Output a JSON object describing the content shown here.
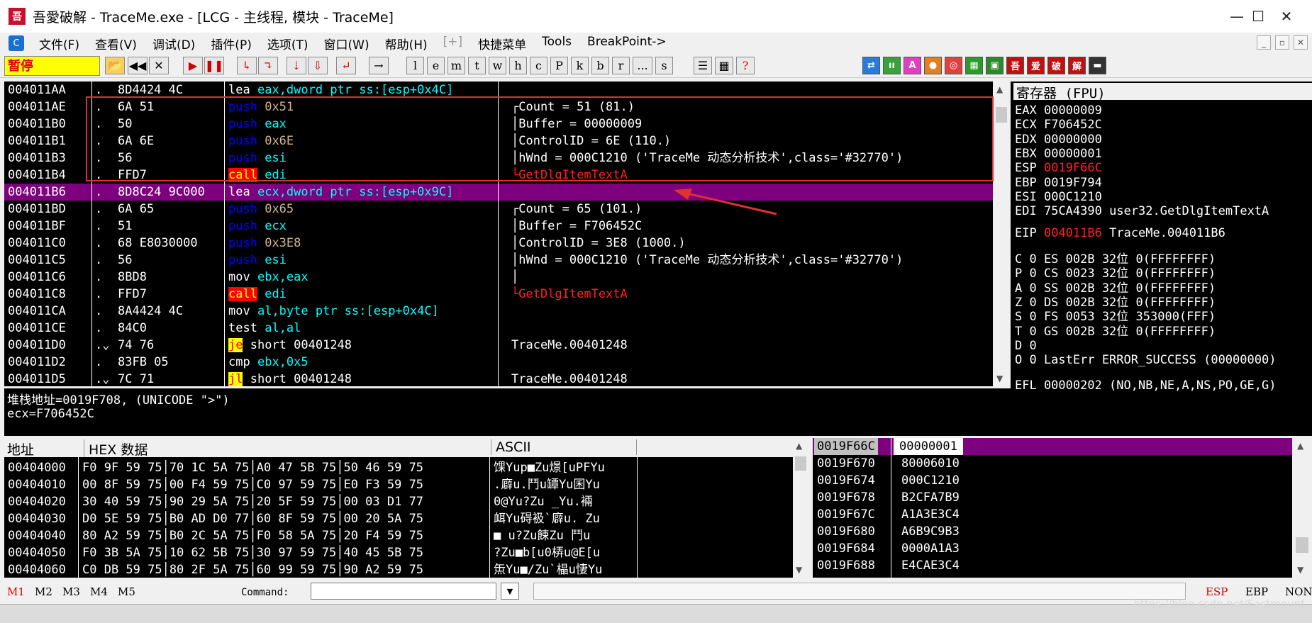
{
  "title": {
    "app_icon_text": "吾",
    "text": "吾愛破解 - TraceMe.exe - [LCG - 主线程, 模块 - TraceMe]",
    "min": "—",
    "max": "☐",
    "close": "✕"
  },
  "menu": {
    "icon_text": "C",
    "items": [
      "文件(F)",
      "查看(V)",
      "调试(D)",
      "插件(P)",
      "选项(T)",
      "窗口(W)",
      "帮助(H)",
      "[+]",
      "快捷菜单",
      "Tools",
      "BreakPoint->"
    ],
    "mdi": [
      "_",
      "▫",
      "✕"
    ]
  },
  "toolbar": {
    "status": "暂停",
    "letters": [
      "l",
      "e",
      "m",
      "t",
      "w",
      "h",
      "c",
      "P",
      "k",
      "b",
      "r",
      "...",
      "s"
    ],
    "nav": [
      "◀◀",
      "✕",
      "▶",
      "❚❚"
    ],
    "right_colored": [
      "⇄",
      "ıı",
      "A",
      "●",
      "◎",
      "▦",
      "▣",
      "吾",
      "爱",
      "破",
      "解",
      "▬"
    ]
  },
  "cpu": {
    "rows": [
      {
        "addr": "004011AA",
        "dot": ".",
        "hex": "8D4424 4C",
        "op": "lea",
        "args": "eax,dword ptr ss:[esp+0x4C]",
        "argclass": "arg-cyan",
        "comment": ""
      },
      {
        "addr": "004011AE",
        "dot": ".",
        "hex": "6A 51",
        "op": "push",
        "args": "0x51",
        "argclass": "arg-num",
        "comment": "┌Count = 51 (81.)"
      },
      {
        "addr": "004011B0",
        "dot": ".",
        "hex": "50",
        "op": "push",
        "args": "eax",
        "argclass": "arg-cyan",
        "comment": "│Buffer = 00000009"
      },
      {
        "addr": "004011B1",
        "dot": ".",
        "hex": "6A 6E",
        "op": "push",
        "args": "0x6E",
        "argclass": "arg-num",
        "comment": "│ControlID = 6E (110.)"
      },
      {
        "addr": "004011B3",
        "dot": ".",
        "hex": "56",
        "op": "push",
        "args": "esi",
        "argclass": "arg-cyan",
        "comment": "│hWnd = 000C1210 ('TraceMe 动态分析技术',class='#32770')"
      },
      {
        "addr": "004011B4",
        "dot": ".",
        "hex": "FFD7",
        "op": "call",
        "args": "edi",
        "argclass": "arg-cyan",
        "comment": "└GetDlgItemTextA"
      },
      {
        "addr": "004011B6",
        "dot": ".",
        "hex": "8D8C24 9C000",
        "op": "lea",
        "args": "ecx,dword ptr ss:[esp+0x9C]",
        "argclass": "arg-cyan",
        "comment": ""
      },
      {
        "addr": "004011BD",
        "dot": ".",
        "hex": "6A 65",
        "op": "push",
        "args": "0x65",
        "argclass": "arg-num",
        "comment": "┌Count = 65 (101.)"
      },
      {
        "addr": "004011BF",
        "dot": ".",
        "hex": "51",
        "op": "push",
        "args": "ecx",
        "argclass": "arg-cyan",
        "comment": "│Buffer = F706452C"
      },
      {
        "addr": "004011C0",
        "dot": ".",
        "hex": "68 E8030000",
        "op": "push",
        "args": "0x3E8",
        "argclass": "arg-num",
        "comment": "│ControlID = 3E8 (1000.)"
      },
      {
        "addr": "004011C5",
        "dot": ".",
        "hex": "56",
        "op": "push",
        "args": "esi",
        "argclass": "arg-cyan",
        "comment": "│hWnd = 000C1210 ('TraceMe 动态分析技术',class='#32770')"
      },
      {
        "addr": "004011C6",
        "dot": ".",
        "hex": "8BD8",
        "op": "mov",
        "args": "ebx,eax",
        "argclass": "arg-cyan",
        "comment": "│"
      },
      {
        "addr": "004011C8",
        "dot": ".",
        "hex": "FFD7",
        "op": "call",
        "args": "edi",
        "argclass": "arg-cyan",
        "comment": "└GetDlgItemTextA"
      },
      {
        "addr": "004011CA",
        "dot": ".",
        "hex": "8A4424 4C",
        "op": "mov",
        "args": "al,byte ptr ss:[esp+0x4C]",
        "argclass": "arg-cyan",
        "comment": ""
      },
      {
        "addr": "004011CE",
        "dot": ".",
        "hex": "84C0",
        "op": "test",
        "args": "al,al",
        "argclass": "arg-cyan",
        "comment": ""
      },
      {
        "addr": "004011D0",
        "dot": ".⌄",
        "hex": "74 76",
        "op": "je",
        "args": "short 00401248",
        "argclass": "",
        "comment": "TraceMe.00401248"
      },
      {
        "addr": "004011D2",
        "dot": ".",
        "hex": "83FB 05",
        "op": "cmp",
        "args": "ebx,0x5",
        "argclass": "arg-cyan",
        "comment": ""
      },
      {
        "addr": "004011D5",
        "dot": ".⌄",
        "hex": "7C 71",
        "op": "jl",
        "args": "short 00401248",
        "argclass": "",
        "comment": "TraceMe.00401248"
      }
    ]
  },
  "regs": {
    "title": "寄存器 (FPU)",
    "list": [
      {
        "name": "EAX",
        "val": "00000009",
        "extra": "",
        "red": false
      },
      {
        "name": "ECX",
        "val": "F706452C",
        "extra": "",
        "red": false
      },
      {
        "name": "EDX",
        "val": "00000000",
        "extra": "",
        "red": false
      },
      {
        "name": "EBX",
        "val": "00000001",
        "extra": "",
        "red": false
      },
      {
        "name": "ESP",
        "val": "0019F66C",
        "extra": "",
        "red": true
      },
      {
        "name": "EBP",
        "val": "0019F794",
        "extra": "",
        "red": false
      },
      {
        "name": "ESI",
        "val": "000C1210",
        "extra": "",
        "red": false
      },
      {
        "name": "EDI",
        "val": "75CA4390",
        "extra": "user32.GetDlgItemTextA",
        "red": false
      }
    ],
    "eip": {
      "name": "EIP",
      "val": "004011B6",
      "extra": "TraceMe.004011B6"
    },
    "flags": [
      "C 0  ES 002B 32位 0(FFFFFFFF)",
      "P 0  CS 0023 32位 0(FFFFFFFF)",
      "A 0  SS 002B 32位 0(FFFFFFFF)",
      "Z 0  DS 002B 32位 0(FFFFFFFF)",
      "S 0  FS 0053 32位 353000(FFF)",
      "T 0  GS 002B 32位 0(FFFFFFFF)",
      "D 0"
    ],
    "lasterr": "O 0  LastErr ERROR_SUCCESS (00000000)",
    "efl": "EFL 00000202 (NO,NB,NE,A,NS,PO,GE,G)"
  },
  "info": {
    "line1": "堆栈地址=0019F708, (UNICODE \">\")",
    "line2": "ecx=F706452C"
  },
  "dump": {
    "hdr_addr": "地址",
    "hdr_hex": "HEX 数据",
    "hdr_ascii": "ASCII",
    "rows": [
      {
        "addr": "00404000",
        "hex": "F0 9F 59 75│70 1C 5A 75│A0 47 5B 75│50 46 59 75",
        "ascii": "馃Yup■Zu燝[uPFYu"
      },
      {
        "addr": "00404010",
        "hex": "00 8F 59 75│00 F4 59 75│C0 97 59 75│E0 F3 59 75",
        "ascii": ".廦u.鬥u罈Yu囷Yu"
      },
      {
        "addr": "00404020",
        "hex": "30 40 59 75│90 29 5A 75│20 5F 59 75│00 03 D1 77",
        "ascii": "0@Yu?Zu _Yu.裲"
      },
      {
        "addr": "00404030",
        "hex": "D0 5E 59 75│B0 AD D0 77│60 8F 59 75│00 20 5A 75",
        "ascii": "衈Yu碍衱`廦u. Zu"
      },
      {
        "addr": "00404040",
        "hex": "80 A2 59 75│B0 2C 5A 75│F0 58 5A 75│20 F4 59 75",
        "ascii": "■  u?Zu餗Zu 鬥u"
      },
      {
        "addr": "00404050",
        "hex": "F0 3B 5A 75│10 62 5B 75│30 97 59 75│40 45 5B 75",
        "ascii": "?Zu■b[u0梇u@E[u"
      },
      {
        "addr": "00404060",
        "hex": "C0 DB 59 75│80 2F 5A 75│60 99 59 75│90 A2 59 75",
        "ascii": "缹Yu■/Zu`橸u悽Yu"
      }
    ]
  },
  "stack": {
    "rows": [
      {
        "addr": "0019F66C",
        "val": "00000001"
      },
      {
        "addr": "0019F670",
        "val": "80006010"
      },
      {
        "addr": "0019F674",
        "val": "000C1210"
      },
      {
        "addr": "0019F678",
        "val": "B2CFA7B9"
      },
      {
        "addr": "0019F67C",
        "val": "A1A3E3C4"
      },
      {
        "addr": "0019F680",
        "val": "A6B9C9B3"
      },
      {
        "addr": "0019F684",
        "val": "0000A1A3"
      },
      {
        "addr": "0019F688",
        "val": "E4CAE3C4"
      }
    ]
  },
  "bottom": {
    "marks": [
      "M1",
      "M2",
      "M3",
      "M4",
      "M5"
    ],
    "command_label": "Command:",
    "command_value": "",
    "right": [
      "ESP",
      "EBP",
      "NONE"
    ]
  },
  "watermark": "https://blog.csdn.net/Eastmount",
  "colors": {
    "accent_red": "#ff0000",
    "selection": "#7f007f",
    "annotation": "#e03030"
  }
}
